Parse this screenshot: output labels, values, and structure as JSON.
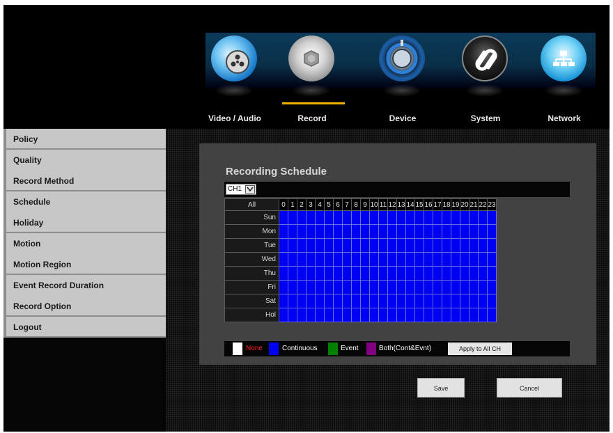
{
  "nav": {
    "tabs": [
      {
        "label": "Video / Audio",
        "icon": "film-reel-icon"
      },
      {
        "label": "Record",
        "icon": "camera-shutter-icon"
      },
      {
        "label": "Device",
        "icon": "power-knob-icon"
      },
      {
        "label": "System",
        "icon": "system-swirl-icon"
      },
      {
        "label": "Network",
        "icon": "network-hierarchy-icon"
      }
    ],
    "active": "Record"
  },
  "sidebar": {
    "items": [
      {
        "label": "Policy"
      },
      {
        "label": "Quality"
      },
      {
        "label": "Record Method"
      },
      {
        "label": "Schedule"
      },
      {
        "label": "Holiday"
      },
      {
        "label": "Motion"
      },
      {
        "label": "Motion Region"
      },
      {
        "label": "Event Record Duration"
      },
      {
        "label": "Record Option"
      },
      {
        "label": "Logout"
      }
    ]
  },
  "schedule": {
    "title": "Recording Schedule",
    "channel": "CH1",
    "all_label": "All",
    "hours": [
      "0",
      "1",
      "2",
      "3",
      "4",
      "5",
      "6",
      "7",
      "8",
      "9",
      "10",
      "11",
      "12",
      "13",
      "14",
      "15",
      "16",
      "17",
      "18",
      "19",
      "20",
      "21",
      "22",
      "23"
    ],
    "days": [
      "Sun",
      "Mon",
      "Tue",
      "Wed",
      "Thu",
      "Fri",
      "Sat",
      "Hol"
    ],
    "fill_mode": "Continuous",
    "colors": {
      "none": "#ffffff",
      "continuous": "#0000f2",
      "event": "#008000",
      "both": "#800080"
    }
  },
  "legend": {
    "none": "None",
    "continuous": "Continuous",
    "event": "Event",
    "both": "Both(Cont&Evnt)",
    "apply": "Apply to All CH"
  },
  "actions": {
    "save": "Save",
    "cancel": "Cancel"
  }
}
